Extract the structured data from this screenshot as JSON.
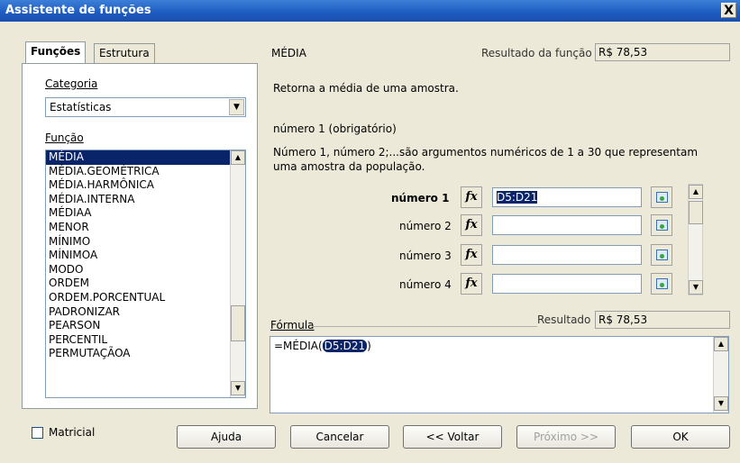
{
  "window": {
    "title": "Assistente de funções",
    "close_label": "X"
  },
  "tabs": [
    {
      "label": "Funções"
    },
    {
      "label": "Estrutura"
    }
  ],
  "category": {
    "label": "Categoria",
    "value": "Estatísticas"
  },
  "function": {
    "label": "Função",
    "items": [
      "MÉDIA",
      "MÉDIA.GEOMÉTRICA",
      "MÉDIA.HARMÔNICA",
      "MÉDIA.INTERNA",
      "MÉDIAA",
      "MENOR",
      "MÍNIMO",
      "MÍNIMOA",
      "MODO",
      "ORDEM",
      "ORDEM.PORCENTUAL",
      "PADRONIZAR",
      "PEARSON",
      "PERCENTIL",
      "PERMUTAÇÃOA"
    ],
    "selected": "MÉDIA"
  },
  "details": {
    "name": "MÉDIA",
    "result_label": "Resultado da função",
    "result_value": "R$ 78,53",
    "description": "Retorna a média de uma amostra.",
    "param_title": "número 1 (obrigatório)",
    "param_desc_1": "Número 1, número 2;...são argumentos numéricos de 1 a 30 que representam",
    "param_desc_2": "uma amostra da população."
  },
  "arguments": [
    {
      "label": "número 1",
      "value": "D5:D21"
    },
    {
      "label": "número 2",
      "value": ""
    },
    {
      "label": "número 3",
      "value": ""
    },
    {
      "label": "número 4",
      "value": ""
    }
  ],
  "fx_glyph": "fx",
  "formula": {
    "label": "Fórmula",
    "result_label": "Resultado",
    "result_value": "R$ 78,53",
    "prefix": "=MÉDIA(",
    "highlight": "D5:D21",
    "suffix": ")"
  },
  "buttons": {
    "array_label": "Matricial",
    "help": "Ajuda",
    "cancel": "Cancelar",
    "back": "<< Voltar",
    "next": "Próximo >>",
    "ok": "OK"
  },
  "icons": {
    "dropdown": "chevron-down-icon",
    "scroll_up": "arrow-up-icon",
    "scroll_down": "arrow-down-icon",
    "fx": "function-icon",
    "pick": "shrink-dialog-icon"
  }
}
